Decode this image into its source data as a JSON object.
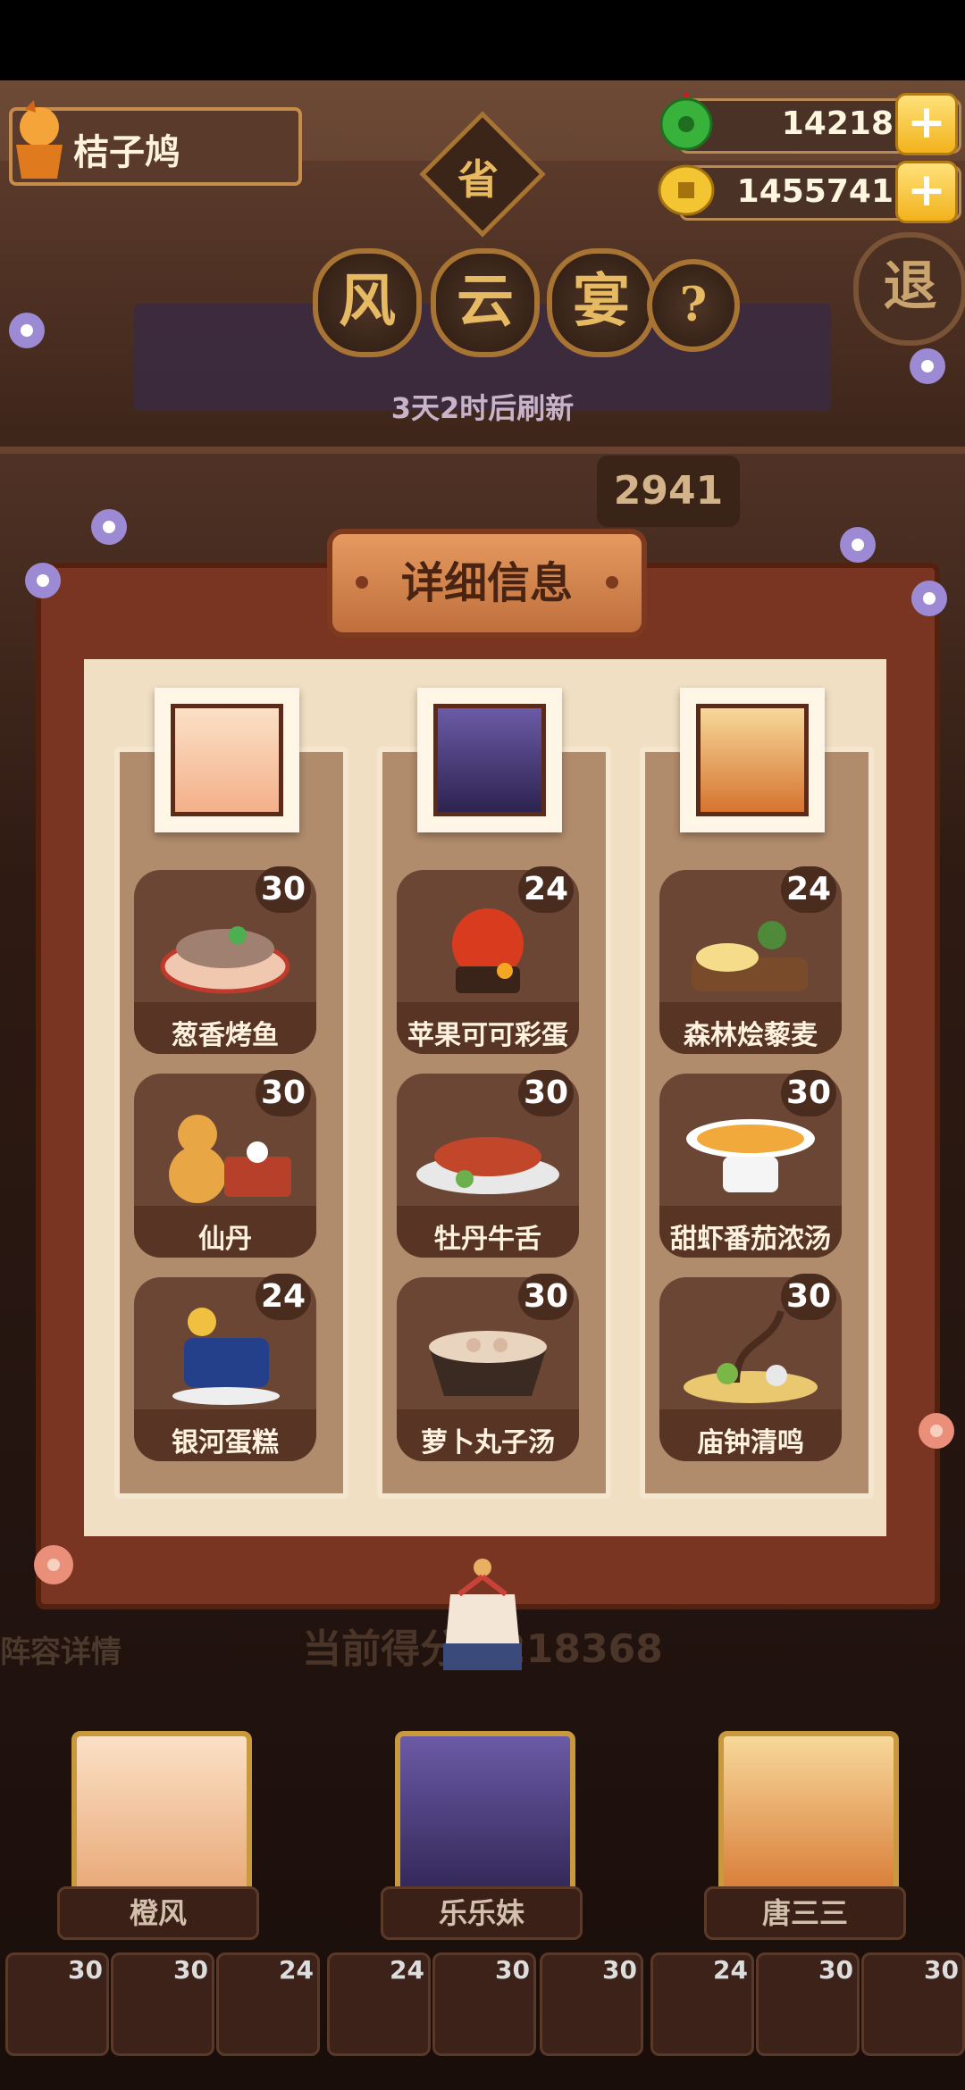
{
  "player": {
    "name": "桔子鸠"
  },
  "currency": {
    "jade": "14218",
    "coins": "1455741",
    "plus": "+"
  },
  "header": {
    "province_glyph": "省",
    "title_chars": [
      "风",
      "云",
      "宴"
    ],
    "help": "?",
    "refresh_text": "3天2时后刷新",
    "exit": "退",
    "score_tag": "2941"
  },
  "modal": {
    "title": "详细信息",
    "columns": [
      {
        "dishes": [
          {
            "name": "葱香烤鱼",
            "value": "30"
          },
          {
            "name": "仙丹",
            "value": "30"
          },
          {
            "name": "银河蛋糕",
            "value": "24"
          }
        ]
      },
      {
        "dishes": [
          {
            "name": "苹果可可彩蛋",
            "value": "24"
          },
          {
            "name": "牡丹牛舌",
            "value": "30"
          },
          {
            "name": "萝卜丸子汤",
            "value": "30"
          }
        ]
      },
      {
        "dishes": [
          {
            "name": "森林烩藜麦",
            "value": "24"
          },
          {
            "name": "甜虾番茄浓汤",
            "value": "30"
          },
          {
            "name": "庙钟清鸣",
            "value": "30"
          }
        ]
      }
    ]
  },
  "bottom": {
    "lineup_label": "阵容详情",
    "current_score": "当前得分：218368",
    "heroes": [
      "橙风",
      "乐乐妹",
      "唐三三"
    ],
    "slots": [
      "30",
      "30",
      "24",
      "24",
      "30",
      "30",
      "24",
      "30",
      "30"
    ]
  },
  "colors": {
    "accent": "#f2b21c",
    "frame": "#7a3522",
    "paper": "#f1dfc3"
  }
}
